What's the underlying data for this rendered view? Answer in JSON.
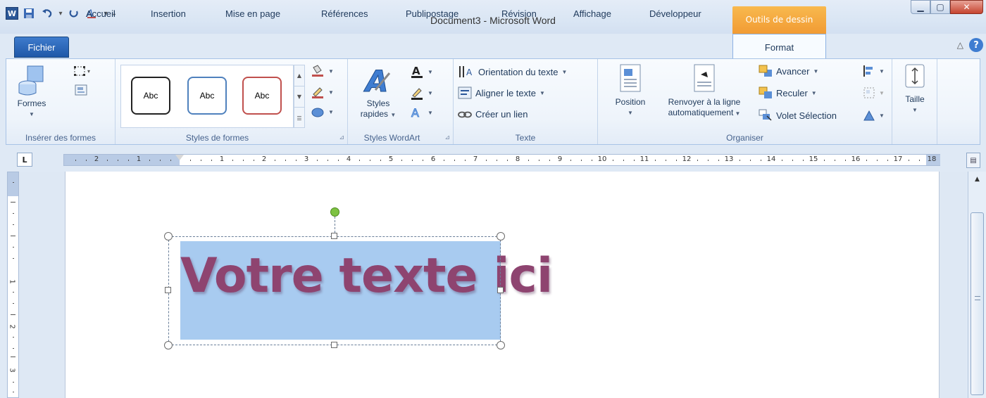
{
  "window": {
    "title": "Document3 - Microsoft Word",
    "contextual_tab_group": "Outils de dessin",
    "app_icon_letter": "W"
  },
  "quick_access": {
    "icons": [
      "save-icon",
      "undo-icon",
      "redo-icon",
      "text-effect-icon",
      "customize-icon"
    ]
  },
  "tabs": {
    "file": "Fichier",
    "items": [
      "Accueil",
      "Insertion",
      "Mise en page",
      "Références",
      "Publipostage",
      "Révision",
      "Affichage",
      "Développeur"
    ],
    "active": "Format"
  },
  "ribbon": {
    "insert_shapes": {
      "label": "Insérer des formes",
      "shapes_button": "Formes"
    },
    "shape_styles": {
      "label": "Styles de formes",
      "thumbs": [
        {
          "text": "Abc",
          "border": "#222222"
        },
        {
          "text": "Abc",
          "border": "#4f81bd"
        },
        {
          "text": "Abc",
          "border": "#c0504d"
        }
      ]
    },
    "wordart_styles": {
      "label": "Styles WordArt",
      "quick_styles_line1": "Styles",
      "quick_styles_line2": "rapides"
    },
    "text": {
      "label": "Texte",
      "orientation": "Orientation du texte",
      "align": "Aligner le texte",
      "link": "Créer un lien"
    },
    "arrange": {
      "label": "Organiser",
      "position": "Position",
      "wrap_line1": "Renvoyer à la ligne",
      "wrap_line2": "automatiquement",
      "bring_forward": "Avancer",
      "send_backward": "Reculer",
      "selection_pane": "Volet Sélection"
    },
    "size": {
      "label": "Taille"
    }
  },
  "ruler": {
    "horizontal_left": [
      "2",
      "1"
    ],
    "horizontal_right": [
      "1",
      "2",
      "3",
      "4",
      "5",
      "6",
      "7",
      "8",
      "9",
      "10",
      "11",
      "12",
      "13",
      "14",
      "15",
      "16",
      "17",
      "18"
    ],
    "vertical": [
      "1",
      "2",
      "3"
    ],
    "tab_selector": "L"
  },
  "document": {
    "shape_text": "Votre texte ici",
    "shape_fill": "#a8cbf0",
    "text_color": "#8e4470"
  },
  "colors": {
    "accent": "#2b579a",
    "contextual": "#f19a33"
  }
}
